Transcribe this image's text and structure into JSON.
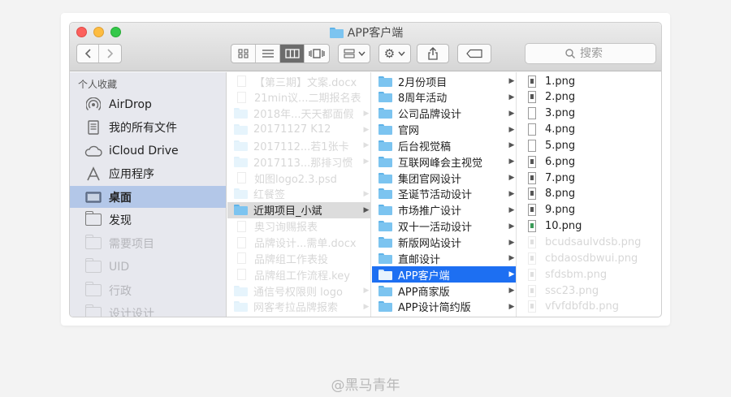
{
  "window": {
    "title": "APP客户端"
  },
  "toolbar": {
    "back_icon": "chevron-left-icon",
    "forward_icon": "chevron-right-icon",
    "views": [
      "icon-view",
      "list-view",
      "column-view",
      "coverflow-view"
    ],
    "active_view": "column-view",
    "search_placeholder": "搜索"
  },
  "sidebar": {
    "header": "个人收藏",
    "items": [
      {
        "label": "AirDrop",
        "icon": "airdrop-icon"
      },
      {
        "label": "我的所有文件",
        "icon": "all-files-icon"
      },
      {
        "label": "iCloud Drive",
        "icon": "cloud-icon"
      },
      {
        "label": "应用程序",
        "icon": "applications-icon"
      },
      {
        "label": "桌面",
        "icon": "desktop-icon",
        "selected": true
      },
      {
        "label": "发现",
        "icon": "folder-icon"
      },
      {
        "label": "需要项目",
        "icon": "folder-icon"
      },
      {
        "label": "UID",
        "icon": "folder-icon"
      },
      {
        "label": "行政",
        "icon": "folder-icon"
      },
      {
        "label": "设计设计",
        "icon": "folder-icon"
      }
    ]
  },
  "column1": [
    {
      "label": "【第三期】文案.docx",
      "type": "doc"
    },
    {
      "label": "21min议...二期报名表",
      "type": "doc"
    },
    {
      "label": "2018年...天天都面假",
      "type": "folder"
    },
    {
      "label": "20171127 K12",
      "type": "folder"
    },
    {
      "label": "2017112...若1张卡",
      "type": "folder"
    },
    {
      "label": "2017113...那排习惯",
      "type": "folder"
    },
    {
      "label": "如图logo2.3.psd",
      "type": "doc"
    },
    {
      "label": "红餐签",
      "type": "folder"
    },
    {
      "label": "近期项目_小斌",
      "type": "folder",
      "selected": true
    },
    {
      "label": "奥习询赐报表",
      "type": "doc"
    },
    {
      "label": "品牌设计...需单.docx",
      "type": "doc"
    },
    {
      "label": "品牌组工作表投",
      "type": "doc"
    },
    {
      "label": "品牌组工作流程.key",
      "type": "doc"
    },
    {
      "label": "通信号权限则 logo",
      "type": "folder"
    },
    {
      "label": "网客考拉品牌报索",
      "type": "folder"
    }
  ],
  "column2": [
    {
      "label": "2月份项目"
    },
    {
      "label": "8周年活动"
    },
    {
      "label": "公司品牌设计"
    },
    {
      "label": "官网"
    },
    {
      "label": "后台视觉稿"
    },
    {
      "label": "互联网峰会主视觉"
    },
    {
      "label": "集团官网设计"
    },
    {
      "label": "圣诞节活动设计"
    },
    {
      "label": "市场推广设计"
    },
    {
      "label": "双十一活动设计"
    },
    {
      "label": "新版网站设计"
    },
    {
      "label": "直邮设计"
    },
    {
      "label": "APP客户端",
      "selected": true
    },
    {
      "label": "APP商家版"
    },
    {
      "label": "APP设计简约版"
    }
  ],
  "column3": [
    {
      "label": "1.png"
    },
    {
      "label": "2.png"
    },
    {
      "label": "3.png"
    },
    {
      "label": "4.png"
    },
    {
      "label": "5.png"
    },
    {
      "label": "6.png"
    },
    {
      "label": "7.png"
    },
    {
      "label": "8.png"
    },
    {
      "label": "9.png"
    },
    {
      "label": "10.png"
    },
    {
      "label": "bcudsaulvdsb.png",
      "faint": true
    },
    {
      "label": "cbdaosdbwui.png",
      "faint": true
    },
    {
      "label": "sfdsbm.png",
      "faint": true
    },
    {
      "label": "ssc23.png",
      "faint": true
    },
    {
      "label": "vfvfdbfdb.png",
      "faint": true
    }
  ],
  "watermark": "@黑马青年"
}
